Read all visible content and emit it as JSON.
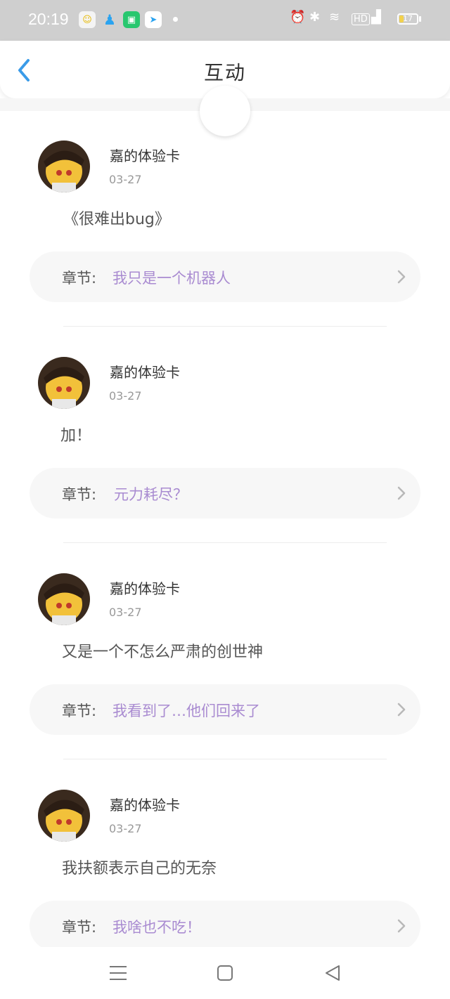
{
  "status_bar": {
    "time": "20:19",
    "battery": "17"
  },
  "header": {
    "title": "互动"
  },
  "posts": [
    {
      "user": "嘉的体验卡",
      "date": "03-27",
      "comment": "《很难出bug》",
      "chapter_prefix": "章节:",
      "chapter_title": "我只是一个机器人"
    },
    {
      "user": "嘉的体验卡",
      "date": "03-27",
      "comment": "加！",
      "chapter_prefix": "章节:",
      "chapter_title": "元力耗尽？"
    },
    {
      "user": "嘉的体验卡",
      "date": "03-27",
      "comment": "又是一个不怎么严肃的创世神",
      "chapter_prefix": "章节:",
      "chapter_title": "我看到了…他们回来了"
    },
    {
      "user": "嘉的体验卡",
      "date": "03-27",
      "comment": "我扶额表示自己的无奈",
      "chapter_prefix": "章节:",
      "chapter_title": "我啥也不吃！"
    }
  ],
  "colors": {
    "accent": "#3a9be8",
    "chapter_text": "#a98bd1",
    "status_bar_bg": "#cfcfcf"
  }
}
